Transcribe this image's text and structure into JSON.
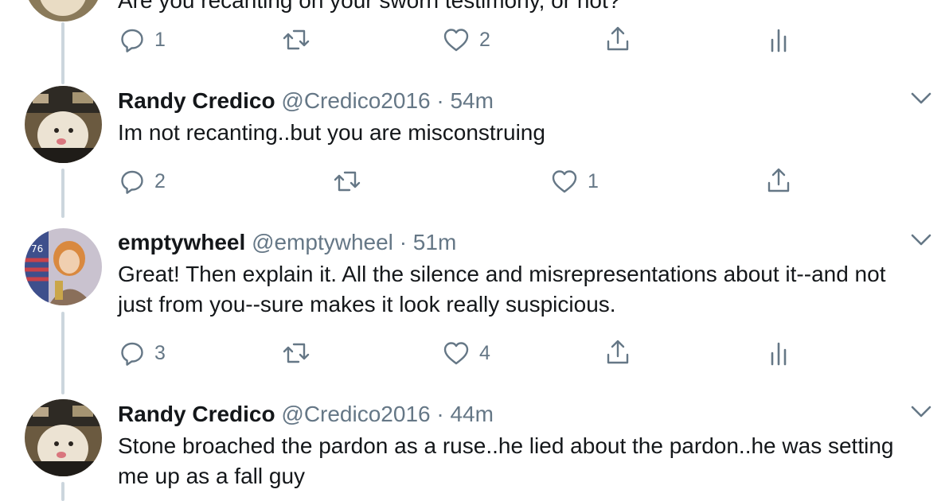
{
  "top_tweet": {
    "text_partial": "Are you recanting on your sworn testimony, or not?",
    "actions": {
      "reply_count": "1",
      "retweet_count": "",
      "like_count": "2"
    }
  },
  "tweets": [
    {
      "name": "Randy Credico",
      "handle": "@Credico2016",
      "separator": "·",
      "time": "54m",
      "text": "Im not recanting..but you are misconstruing",
      "reply_count": "2",
      "retweet_count": "",
      "like_count": "1"
    },
    {
      "name": "emptywheel",
      "handle": "@emptywheel",
      "separator": "·",
      "time": "51m",
      "text": "Great! Then explain it. All the silence and misrepresentations about it--and not just from you--sure makes it look really suspicious.",
      "reply_count": "3",
      "retweet_count": "",
      "like_count": "4"
    },
    {
      "name": "Randy Credico",
      "handle": "@Credico2016",
      "separator": "·",
      "time": "44m",
      "text": "Stone broached the pardon as a ruse..he lied about the pardon..he was setting me up as a fall guy"
    }
  ],
  "icons": {
    "reply": "reply-icon",
    "retweet": "retweet-icon",
    "like": "like-icon",
    "share": "share-icon",
    "analytics": "analytics-icon",
    "caret": "chevron-down-icon"
  },
  "colors": {
    "text_primary": "#14171a",
    "text_secondary": "#657786",
    "thread_line": "#ccd6dd"
  }
}
